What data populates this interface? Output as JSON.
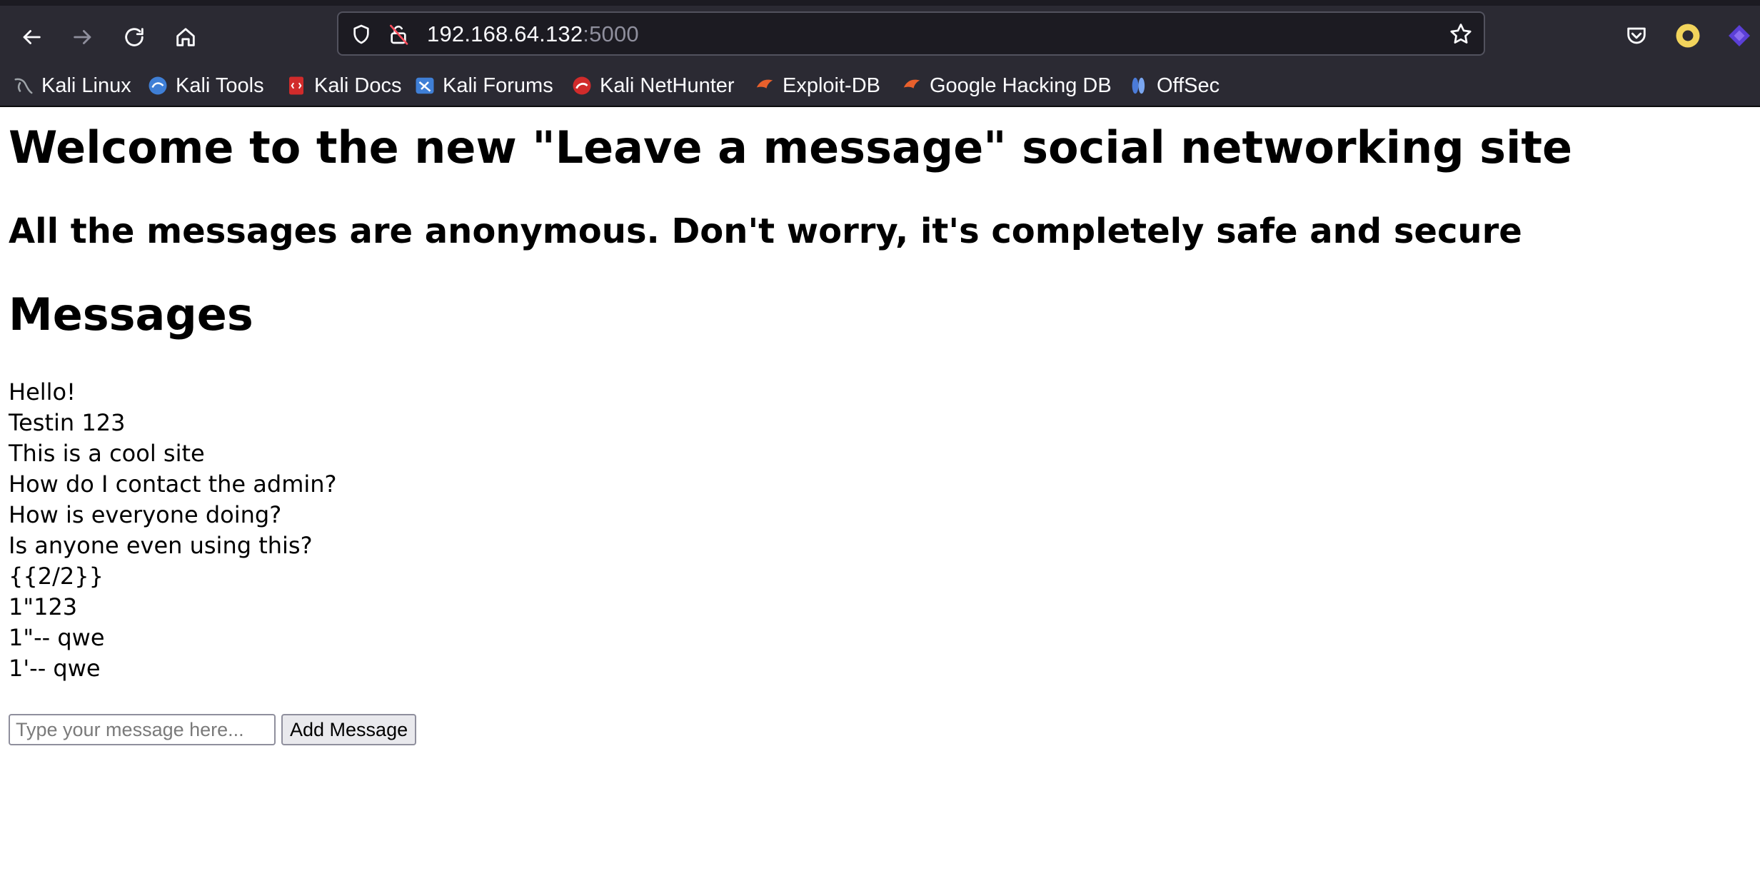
{
  "browser": {
    "url_host": "192.168.64.132",
    "url_port": ":5000",
    "icons": {
      "back": "arrow-left-icon",
      "forward": "arrow-right-icon",
      "reload": "reload-icon",
      "home": "home-icon",
      "site_info": "shield-icon",
      "insecure": "insecure-lock-icon",
      "bookmark": "star-icon",
      "pocket": "pocket-icon",
      "profile": "profile-icon",
      "extension": "extension-icon"
    },
    "bookmarks": [
      {
        "label": "Kali Linux",
        "icon": "kali-dragon-icon",
        "color": "#9ea3a8"
      },
      {
        "label": "Kali Tools",
        "icon": "kali-tools-icon",
        "color": "#3f7fd6"
      },
      {
        "label": "Kali Docs",
        "icon": "kali-docs-icon",
        "color": "#d12b2b"
      },
      {
        "label": "Kali Forums",
        "icon": "kali-forums-icon",
        "color": "#3f7fd6"
      },
      {
        "label": "Kali NetHunter",
        "icon": "nethunter-icon",
        "color": "#d12b2b"
      },
      {
        "label": "Exploit-DB",
        "icon": "exploit-db-icon",
        "color": "#e8602c"
      },
      {
        "label": "Google Hacking DB",
        "icon": "ghdb-icon",
        "color": "#e8602c"
      },
      {
        "label": "OffSec",
        "icon": "offsec-icon",
        "color": "#4b7bd8"
      }
    ]
  },
  "page": {
    "title": "Welcome to the new \"Leave a message\" social networking site",
    "subtitle": "All the messages are anonymous. Don't worry, it's completely safe and secure",
    "messages_heading": "Messages",
    "messages": [
      "Hello!",
      "Testin 123",
      "This is a cool site",
      "How do I contact the admin?",
      "How is everyone doing?",
      "Is anyone even using this?",
      "{{2/2}}",
      "1\"123",
      "1\"-- qwe",
      "1'-- qwe"
    ],
    "input_placeholder": "Type your message here...",
    "input_value": "",
    "add_button": "Add Message"
  }
}
